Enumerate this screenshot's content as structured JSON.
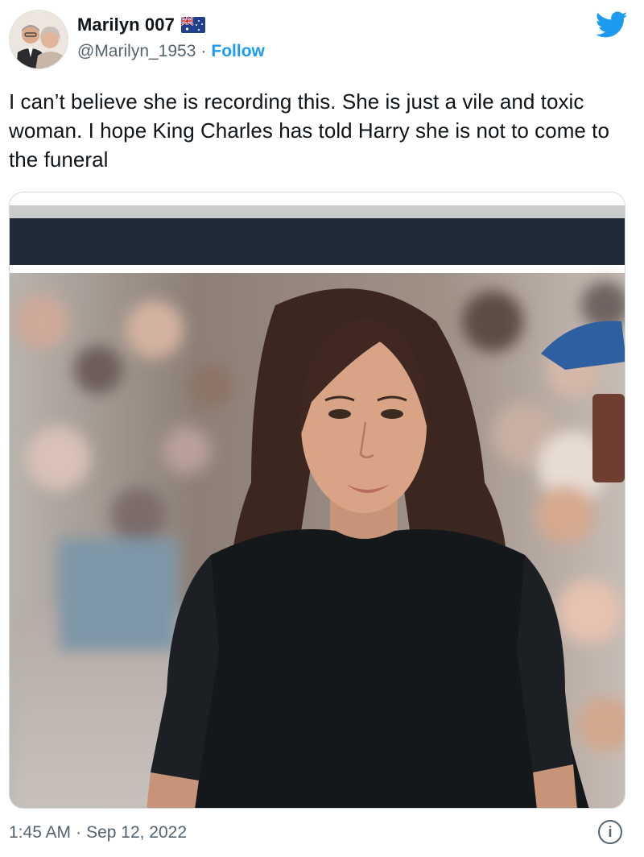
{
  "user": {
    "display_name": "Marilyn 007",
    "handle": "@Marilyn_1953",
    "separator": "·",
    "follow_label": "Follow",
    "flag": "australia-flag-icon"
  },
  "brand": {
    "icon": "twitter-bird-icon",
    "accent": "#1d9bf0"
  },
  "tweet": {
    "text": "I can’t believe she is recording this. She is just a vile and toxic woman. I hope King Charles has told Harry she is not to come to the funeral",
    "time": "1:45 AM",
    "separator": "·",
    "date": "Sep 12, 2022",
    "info_icon": "info-icon"
  },
  "colors": {
    "text_primary": "#0f1419",
    "text_secondary": "#536471",
    "border": "#cfd9de",
    "media_banner": "#1f2b37"
  }
}
